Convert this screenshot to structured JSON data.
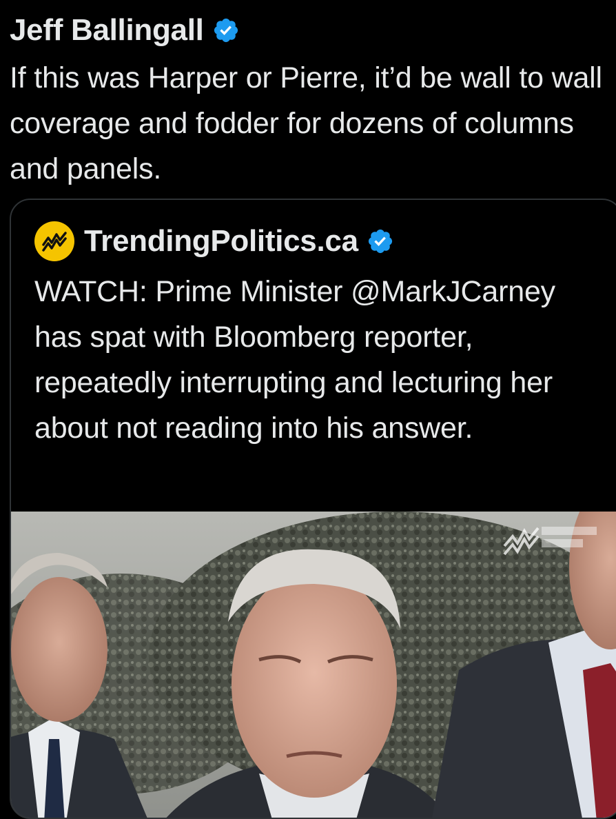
{
  "tweet": {
    "author_name": "Jeff Ballingall",
    "verified_icon": "verified-badge-icon",
    "text": "If this was Harper or Pierre, it’d be wall to wall coverage and fodder for dozens of columns and panels."
  },
  "quote": {
    "author_name": "TrendingPolitics.ca",
    "avatar_icon": "trending-politics-logo",
    "verified_icon": "verified-badge-icon",
    "text": "WATCH: Prime Minister @MarkJCarney has spat with Bloomberg reporter, repeatedly interrupting and lecturing her about not reading into his answer."
  },
  "colors": {
    "background": "#000000",
    "text": "#e7e9ea",
    "verified_blue": "#1d9bf0",
    "card_border": "#2f3336",
    "avatar_yellow": "#f5c400"
  }
}
